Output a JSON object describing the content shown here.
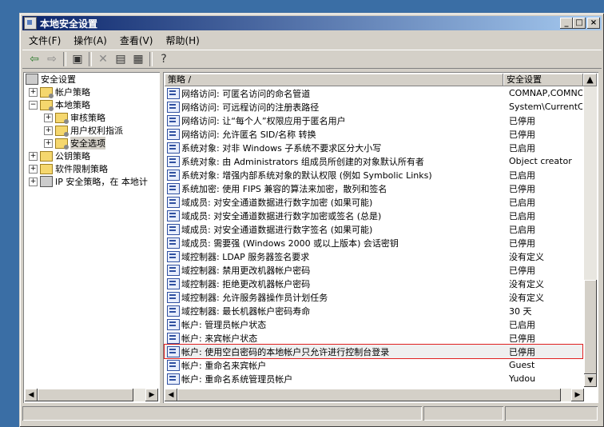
{
  "window": {
    "title": "本地安全设置"
  },
  "menu": {
    "items": [
      "文件(F)",
      "操作(A)",
      "查看(V)",
      "帮助(H)"
    ]
  },
  "tree": {
    "root": "安全设置",
    "account_policy": "帐户策略",
    "local_policy": "本地策略",
    "audit_policy": "审核策略",
    "user_rights": "用户权利指派",
    "security_options": "安全选项",
    "public_key": "公钥策略",
    "software_restriction": "软件限制策略",
    "ip_security": "IP 安全策略，在 本地计"
  },
  "list": {
    "col_policy": "策略 /",
    "col_setting": "安全设置",
    "rows": [
      {
        "policy": "网络访问: 可匿名访问的命名管道",
        "setting": "COMNAP,COMNODE,"
      },
      {
        "policy": "网络访问: 可远程访问的注册表路径",
        "setting": "System\\CurrentC"
      },
      {
        "policy": "网络访问: 让“每个人”权限应用于匿名用户",
        "setting": "已停用"
      },
      {
        "policy": "网络访问: 允许匿名 SID/名称 转换",
        "setting": "已停用"
      },
      {
        "policy": "系统对象: 对非 Windows 子系统不要求区分大小写",
        "setting": "已启用"
      },
      {
        "policy": "系统对象: 由 Administrators 组成员所创建的对象默认所有者",
        "setting": "Object creator"
      },
      {
        "policy": "系统对象: 增强内部系统对象的默认权限 (例如 Symbolic Links)",
        "setting": "已启用"
      },
      {
        "policy": "系统加密: 使用 FIPS 兼容的算法来加密，散列和签名",
        "setting": "已停用"
      },
      {
        "policy": "域成员: 对安全通道数据进行数字加密 (如果可能)",
        "setting": "已启用"
      },
      {
        "policy": "域成员: 对安全通道数据进行数字加密或签名 (总是)",
        "setting": "已启用"
      },
      {
        "policy": "域成员: 对安全通道数据进行数字签名 (如果可能)",
        "setting": "已启用"
      },
      {
        "policy": "域成员: 需要强 (Windows 2000 或以上版本) 会话密钥",
        "setting": "已停用"
      },
      {
        "policy": "域控制器: LDAP 服务器签名要求",
        "setting": "没有定义"
      },
      {
        "policy": "域控制器: 禁用更改机器帐户密码",
        "setting": "已停用"
      },
      {
        "policy": "域控制器: 拒绝更改机器帐户密码",
        "setting": "没有定义"
      },
      {
        "policy": "域控制器: 允许服务器操作员计划任务",
        "setting": "没有定义"
      },
      {
        "policy": "域控制器: 最长机器帐户密码寿命",
        "setting": "30 天"
      },
      {
        "policy": "帐户: 管理员帐户状态",
        "setting": "已启用"
      },
      {
        "policy": "帐户: 来宾帐户状态",
        "setting": "已停用"
      },
      {
        "policy": "帐户: 使用空白密码的本地帐户只允许进行控制台登录",
        "setting": "已停用"
      },
      {
        "policy": "帐户: 重命名来宾帐户",
        "setting": "Guest"
      },
      {
        "policy": "帐户: 重命名系统管理员帐户",
        "setting": "Yudou"
      }
    ]
  }
}
